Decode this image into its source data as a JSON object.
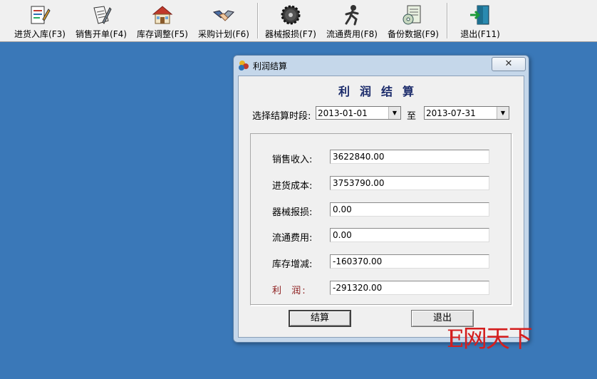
{
  "toolbar": {
    "buttons": [
      {
        "label": "进货入库(F3)",
        "icon": "stock-in-icon"
      },
      {
        "label": "销售开单(F4)",
        "icon": "sales-order-icon"
      },
      {
        "label": "库存调整(F5)",
        "icon": "warehouse-icon"
      },
      {
        "label": "采购计划(F6)",
        "icon": "handshake-icon"
      },
      {
        "label": "器械报损(F7)",
        "icon": "gear-icon"
      },
      {
        "label": "流通费用(F8)",
        "icon": "runner-icon"
      },
      {
        "label": "备份数据(F9)",
        "icon": "backup-disc-icon"
      },
      {
        "label": "退出(F11)",
        "icon": "exit-door-icon"
      }
    ]
  },
  "dialog": {
    "title": "利润结算",
    "close_glyph": "✕",
    "heading": "利润结算",
    "period_label": "选择结算时段:",
    "start_date": "2013-01-01",
    "to_label": "至",
    "end_date": "2013-07-31",
    "fields": [
      {
        "label": "销售收入:",
        "value": "3622840.00"
      },
      {
        "label": "进货成本:",
        "value": "3753790.00"
      },
      {
        "label": "器械报损:",
        "value": "0.00"
      },
      {
        "label": "流通费用:",
        "value": "0.00"
      },
      {
        "label": "库存增减:",
        "value": "-160370.00"
      },
      {
        "label": "利  润:",
        "value": "-291320.00"
      }
    ],
    "calc_button": "结算",
    "exit_button": "退出"
  },
  "watermark": "E网天下",
  "colors": {
    "desktop": "#3a78b8",
    "profit_label": "#8b1a1a",
    "watermark": "#d41e1e"
  }
}
